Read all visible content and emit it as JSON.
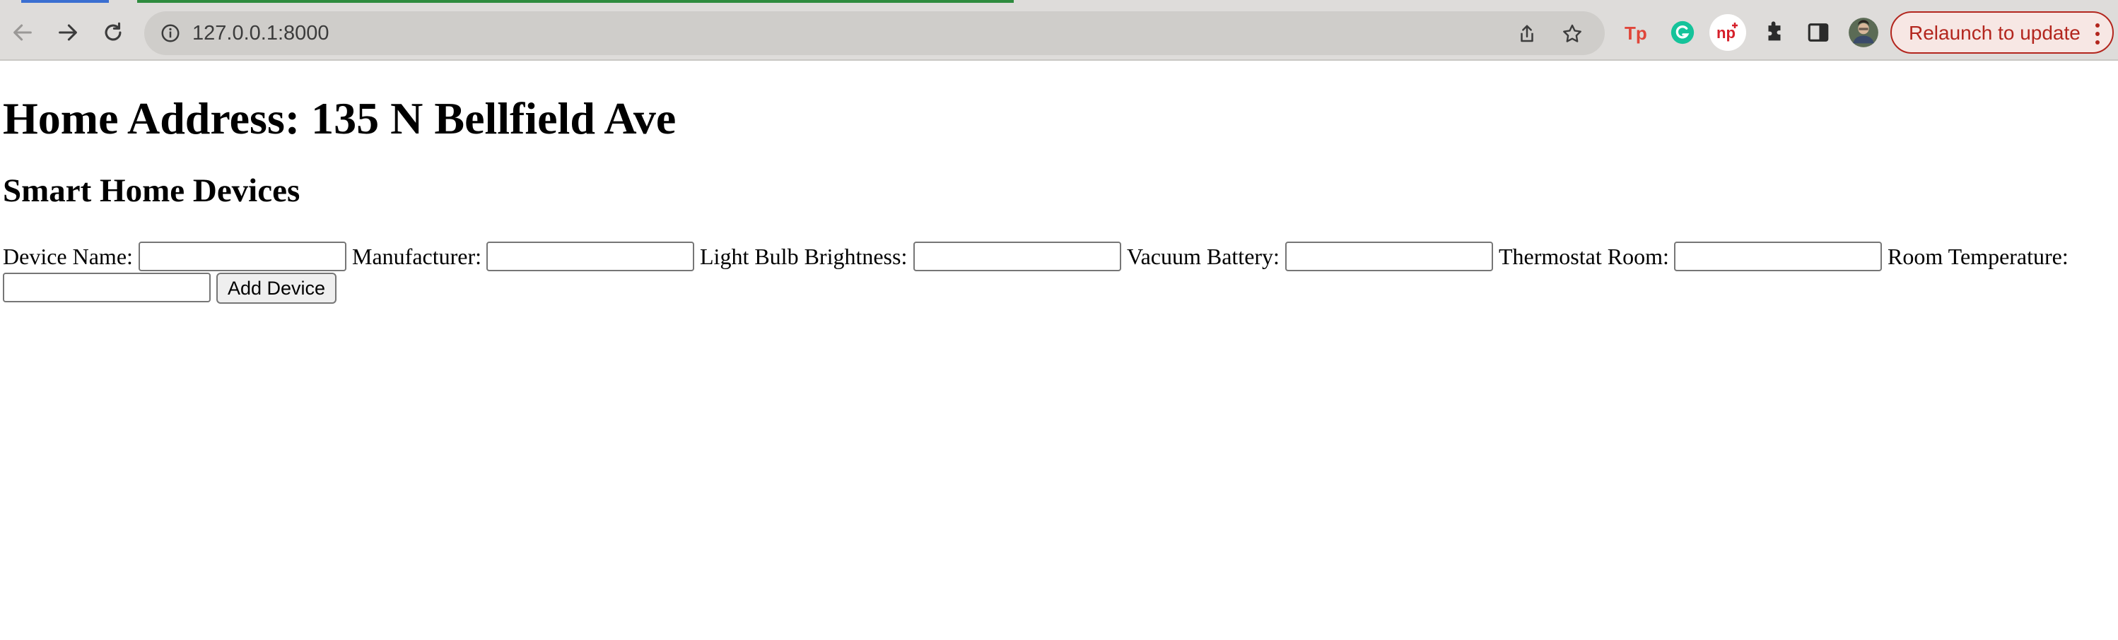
{
  "browser": {
    "url": "127.0.0.1:8000",
    "relaunch_label": "Relaunch to update",
    "icons": {
      "back": "back-arrow-icon",
      "forward": "forward-arrow-icon",
      "reload": "reload-icon",
      "site_info": "info-icon",
      "share": "share-icon",
      "bookmark": "star-icon",
      "ext_tp": "tp-extension-icon",
      "ext_grammarly": "grammarly-icon",
      "ext_np": "np-extension-icon",
      "extensions": "puzzle-piece-icon",
      "side_panel": "side-panel-icon",
      "profile": "avatar",
      "menu": "kebab-menu-icon"
    },
    "colors": {
      "tp": "#e0463a",
      "grammarly": "#15c39a",
      "np": "#d6202a",
      "relaunch": "#b3261e"
    }
  },
  "page": {
    "title": "Home Address: 135 N Bellfield Ave",
    "subtitle": "Smart Home Devices",
    "form": {
      "device_name_label": "Device Name:",
      "manufacturer_label": "Manufacturer:",
      "brightness_label": "Light Bulb Brightness:",
      "vacuum_battery_label": "Vacuum Battery:",
      "thermostat_room_label": "Thermostat Room:",
      "room_temperature_label": "Room Temperature:",
      "device_name_value": "",
      "manufacturer_value": "",
      "brightness_value": "",
      "vacuum_battery_value": "",
      "thermostat_room_value": "",
      "room_temperature_value": "",
      "submit_label": "Add Device"
    }
  }
}
